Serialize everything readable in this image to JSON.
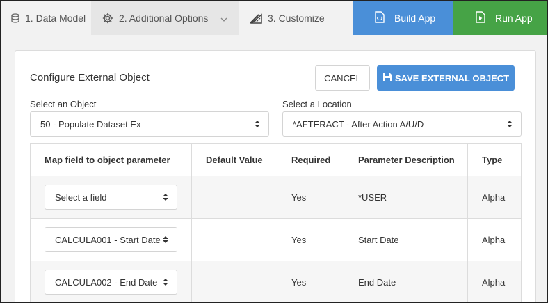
{
  "steps": [
    {
      "label": "1. Data Model",
      "icon": "database-icon"
    },
    {
      "label": "2. Additional Options",
      "icon": "gear-icon"
    },
    {
      "label": "3. Customize",
      "icon": "ruler-pencil-icon"
    }
  ],
  "actions": {
    "build_label": "Build App",
    "run_label": "Run App"
  },
  "card": {
    "title": "Configure External Object",
    "cancel_label": "CANCEL",
    "save_label": "SAVE EXTERNAL OBJECT"
  },
  "object_select": {
    "label": "Select an Object",
    "value": "50 - Populate Dataset Ex"
  },
  "location_select": {
    "label": "Select a Location",
    "value": "*AFTERACT - After Action A/U/D"
  },
  "table": {
    "headers": [
      "Map field to object parameter",
      "Default Value",
      "Required",
      "Parameter Description",
      "Type"
    ],
    "rows": [
      {
        "field": "Select a field",
        "default": "",
        "required": "Yes",
        "description": "*USER",
        "type": "Alpha"
      },
      {
        "field": "CALCULA001 - Start Date",
        "default": "",
        "required": "Yes",
        "description": "Start Date",
        "type": "Alpha"
      },
      {
        "field": "CALCULA002 - End Date",
        "default": "",
        "required": "Yes",
        "description": "End Date",
        "type": "Alpha"
      }
    ]
  },
  "colors": {
    "build": "#4a8fd8",
    "run": "#46a346",
    "save": "#4a8fd8"
  }
}
